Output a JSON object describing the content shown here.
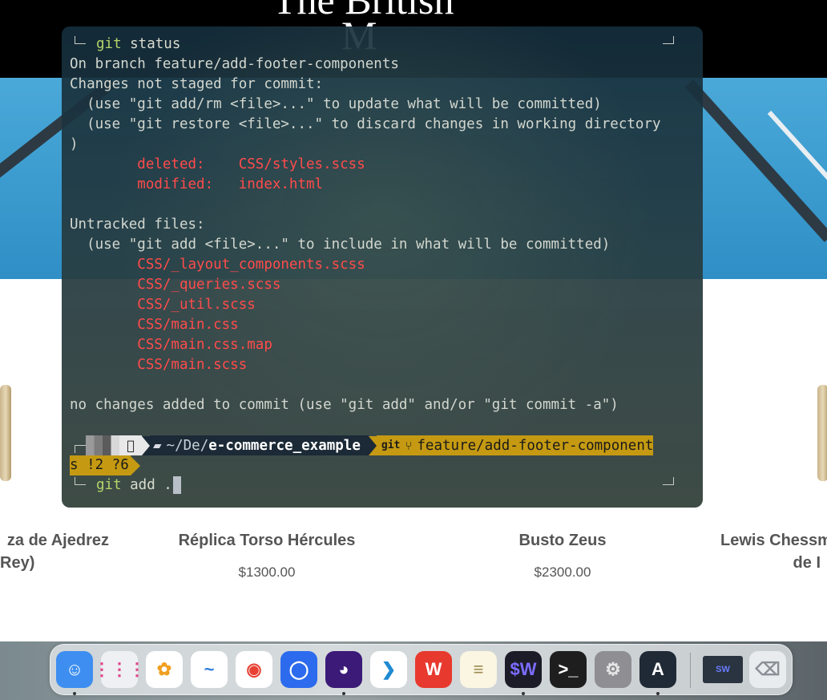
{
  "website": {
    "logo_line1": "The British",
    "logo_line2": "M",
    "products": [
      {
        "name_line1": "za de Ajedrez",
        "name_line2": "Rey)",
        "price": ""
      },
      {
        "name_line1": "Réplica Torso Hércules",
        "name_line2": "",
        "price": "$1300.00"
      },
      {
        "name_line1": "Busto Zeus",
        "name_line2": "",
        "price": "$2300.00"
      },
      {
        "name_line1": "Lewis Chessm",
        "name_line2": "de I",
        "price": ""
      }
    ]
  },
  "terminal": {
    "cmd1_keyword": "git",
    "cmd1_args": " status",
    "lines": [
      "On branch feature/add-footer-components",
      "Changes not staged for commit:",
      "  (use \"git add/rm <file>...\" to update what will be committed)",
      "  (use \"git restore <file>...\" to discard changes in working directory",
      ")"
    ],
    "changes": [
      "        deleted:    CSS/styles.scss",
      "        modified:   index.html"
    ],
    "untracked_header": "Untracked files:",
    "untracked_hint": "  (use \"git add <file>...\" to include in what will be committed)",
    "untracked_files": [
      "        CSS/_layout_components.scss",
      "        CSS/_queries.scss",
      "        CSS/_util.scss",
      "        CSS/main.css",
      "        CSS/main.css.map",
      "        CSS/main.scss"
    ],
    "summary": "no changes added to commit (use \"git add\" and/or \"git commit -a\")",
    "prompt": {
      "path_prefix": "~/De/",
      "path_dir": "e-commerce_example",
      "git_label": "git",
      "branch": "feature/add-footer-component",
      "branch_wrap": "s !2 ?6"
    },
    "cmd2_keyword": "git",
    "cmd2_args": " add ."
  },
  "dock": {
    "apps": [
      {
        "name": "Finder",
        "icon": "finder-icon",
        "color": "#3d8ef0",
        "glyph": "☺",
        "running": true
      },
      {
        "name": "Launchpad",
        "icon": "launchpad-icon",
        "color": "#eef0f3",
        "glyph": "⋮⋮⋮",
        "running": false
      },
      {
        "name": "Photos",
        "icon": "photos-icon",
        "color": "#ffffff",
        "glyph": "✿",
        "running": false
      },
      {
        "name": "Freeform",
        "icon": "freeform-icon",
        "color": "#ffffff",
        "glyph": "~",
        "running": false
      },
      {
        "name": "Chrome",
        "icon": "chrome-icon",
        "color": "#ffffff",
        "glyph": "◉",
        "running": false
      },
      {
        "name": "Signal",
        "icon": "signal-icon",
        "color": "#2c6bed",
        "glyph": "◯",
        "running": false
      },
      {
        "name": "Firefox",
        "icon": "firefox-icon",
        "color": "#3b1a78",
        "glyph": "◕",
        "running": true
      },
      {
        "name": "Visual Studio Code",
        "icon": "vscode-icon",
        "color": "#ffffff",
        "glyph": "❯",
        "running": false
      },
      {
        "name": "WPS Office",
        "icon": "wps-icon",
        "color": "#e8392e",
        "glyph": "W",
        "running": false
      },
      {
        "name": "Notes",
        "icon": "notes-icon",
        "color": "#fbf6e2",
        "glyph": "≡",
        "running": false
      },
      {
        "name": "Warp",
        "icon": "warp-icon",
        "color": "#1c1c28",
        "glyph": "$W",
        "running": true
      },
      {
        "name": "Terminal",
        "icon": "terminal-icon",
        "color": "#1e1e1e",
        "glyph": ">_",
        "running": false
      },
      {
        "name": "System Settings",
        "icon": "settings-icon",
        "color": "#8e8e93",
        "glyph": "⚙",
        "running": false
      },
      {
        "name": "Alacritty",
        "icon": "alacritty-icon",
        "color": "#1f2a36",
        "glyph": "A",
        "running": true
      },
      {
        "name": "Warp Window",
        "icon": "window-thumbnail-icon",
        "color": "#2a3440",
        "glyph": "SW",
        "running": false
      },
      {
        "name": "Trash",
        "icon": "trash-icon",
        "color": "#e9ecef",
        "glyph": "⌫",
        "running": false
      }
    ]
  }
}
